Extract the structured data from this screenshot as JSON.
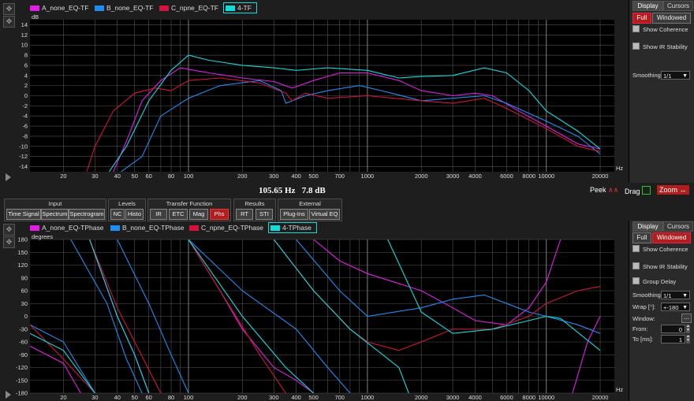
{
  "colors": {
    "A": "#e21ee6",
    "B": "#1e8ef0",
    "C": "#d2143c",
    "D": "#10dcdc",
    "bg": "#000000",
    "grid": "#6e6e6e"
  },
  "top_legend": [
    {
      "label": "A_none_EQ-TF",
      "color": "#e21ee6"
    },
    {
      "label": "B_none_EQ-TF",
      "color": "#1e8ef0"
    },
    {
      "label": "C_npne_EQ-TF",
      "color": "#d2143c"
    },
    {
      "label": "4-TF",
      "color": "#10dcdc"
    }
  ],
  "bottom_legend": [
    {
      "label": "A_none_EQ-TPhase",
      "color": "#e21ee6"
    },
    {
      "label": "B_none_EQ-TPhase",
      "color": "#1e8ef0"
    },
    {
      "label": "C_npne_EQ-TPhase",
      "color": "#d2143c"
    },
    {
      "label": "4-TPhase",
      "color": "#10dcdc"
    }
  ],
  "readout": {
    "freq": "105.65 Hz",
    "level": "7.8 dB"
  },
  "status": {
    "peek": "Peek",
    "drag": "Drag",
    "zoom": "Zoom"
  },
  "right_top": {
    "tab_display": "Display",
    "tab_cursors": "Cursors",
    "full": "Full",
    "windowed": "Windowed",
    "show_coherence": "Show Coherence",
    "show_ir": "Show IR Stability",
    "smoothing_label": "Smoothing",
    "smoothing_value": "1/1"
  },
  "right_bottom": {
    "tab_display": "Display",
    "tab_cursors": "Cursors",
    "full": "Full",
    "windowed": "Windowed",
    "show_coherence": "Show Coherence",
    "show_ir": "Show IR Stability",
    "group_delay": "Group Delay",
    "smoothing_label": "Smoothing",
    "smoothing_value": "1/1",
    "wrap_label": "Wrap [°]:",
    "wrap_value": "+-180",
    "window_label": "Window:",
    "window_btn": "...",
    "from_label": "From:",
    "from_value": "0",
    "to_label": "To [ms]:",
    "to_value": "1"
  },
  "toolbar": {
    "input": {
      "title": "Input",
      "buttons": [
        "Time Signal",
        "Spectrum",
        "Spectrogram"
      ]
    },
    "levels": {
      "title": "Levels",
      "buttons": [
        "NC",
        "Histo"
      ]
    },
    "transfer": {
      "title": "Transfer Function",
      "buttons": [
        "IR",
        "ETC",
        "Mag",
        "Phs"
      ]
    },
    "results": {
      "title": "Results",
      "buttons": [
        "RT",
        "STI"
      ]
    },
    "external": {
      "title": "External",
      "buttons": [
        "Plug-Ins",
        "Virtual EQ"
      ]
    }
  },
  "chart_data": [
    {
      "type": "line",
      "ylabel": "dB",
      "xlabel": "Hz",
      "xscale": "log",
      "xlim": [
        13,
        24000
      ],
      "ylim": [
        -15,
        15
      ],
      "yticks": [
        14,
        12,
        10,
        8,
        6,
        4,
        2,
        0,
        -2,
        -4,
        -6,
        -8,
        -10,
        -12,
        -14
      ],
      "xticks": [
        20,
        30,
        40,
        50,
        60,
        80,
        100,
        200,
        300,
        400,
        500,
        700,
        1000,
        2000,
        3000,
        4000,
        6000,
        8000,
        10000,
        20000
      ],
      "series": [
        {
          "name": "A_none_EQ-TF",
          "color": "#e21ee6",
          "points": [
            [
              38,
              -15
            ],
            [
              45,
              -9
            ],
            [
              55,
              -1
            ],
            [
              70,
              3
            ],
            [
              90,
              5.5
            ],
            [
              130,
              4.5
            ],
            [
              200,
              3.5
            ],
            [
              300,
              2.8
            ],
            [
              380,
              1.5
            ],
            [
              500,
              3
            ],
            [
              700,
              4.5
            ],
            [
              1000,
              4.5
            ],
            [
              1500,
              3
            ],
            [
              2000,
              1
            ],
            [
              3000,
              0
            ],
            [
              4000,
              0.5
            ],
            [
              5000,
              0
            ],
            [
              7000,
              -3
            ],
            [
              10000,
              -6
            ],
            [
              15000,
              -9.5
            ],
            [
              20000,
              -10.5
            ]
          ]
        },
        {
          "name": "B_none_EQ-TF",
          "color": "#1e8ef0",
          "points": [
            [
              42,
              -15
            ],
            [
              55,
              -12
            ],
            [
              70,
              -4
            ],
            [
              100,
              -0.5
            ],
            [
              150,
              2
            ],
            [
              250,
              3
            ],
            [
              330,
              1
            ],
            [
              350,
              -1.5
            ],
            [
              450,
              0
            ],
            [
              600,
              1
            ],
            [
              900,
              2
            ],
            [
              1200,
              1
            ],
            [
              2000,
              -1
            ],
            [
              3000,
              -0.5
            ],
            [
              4500,
              0
            ],
            [
              6000,
              -1.5
            ],
            [
              10000,
              -5
            ],
            [
              15000,
              -8
            ],
            [
              20000,
              -11.5
            ]
          ]
        },
        {
          "name": "C_npne_EQ-TF",
          "color": "#d2143c",
          "points": [
            [
              27,
              -15
            ],
            [
              30,
              -10
            ],
            [
              38,
              -3
            ],
            [
              50,
              0.5
            ],
            [
              65,
              1.5
            ],
            [
              80,
              1
            ],
            [
              100,
              3
            ],
            [
              150,
              3.5
            ],
            [
              250,
              2.5
            ],
            [
              350,
              0.5
            ],
            [
              380,
              -1
            ],
            [
              450,
              0.5
            ],
            [
              600,
              -0.5
            ],
            [
              1000,
              0
            ],
            [
              2000,
              -1
            ],
            [
              3000,
              -1.5
            ],
            [
              4500,
              -0.5
            ],
            [
              6000,
              -2.5
            ],
            [
              10000,
              -6.5
            ],
            [
              15000,
              -10
            ],
            [
              20000,
              -11
            ]
          ]
        },
        {
          "name": "4-TF",
          "color": "#10dcdc",
          "points": [
            [
              36,
              -15
            ],
            [
              45,
              -10
            ],
            [
              60,
              -1
            ],
            [
              80,
              5
            ],
            [
              100,
              8
            ],
            [
              130,
              7
            ],
            [
              200,
              6
            ],
            [
              300,
              5.5
            ],
            [
              400,
              5
            ],
            [
              600,
              5.5
            ],
            [
              1000,
              5
            ],
            [
              1500,
              3.5
            ],
            [
              2000,
              3.8
            ],
            [
              3000,
              4
            ],
            [
              4500,
              5.5
            ],
            [
              6000,
              4.5
            ],
            [
              8000,
              1
            ],
            [
              10000,
              -3
            ],
            [
              15000,
              -7
            ],
            [
              20000,
              -10.5
            ]
          ]
        }
      ]
    },
    {
      "type": "line",
      "ylabel": "degrees",
      "xlabel": "Hz",
      "xscale": "log",
      "xlim": [
        13,
        24000
      ],
      "ylim": [
        -180,
        180
      ],
      "yticks": [
        180,
        150,
        120,
        90,
        60,
        30,
        0,
        -30,
        -60,
        -90,
        -120,
        -150,
        -180
      ],
      "xticks": [
        20,
        30,
        40,
        50,
        60,
        80,
        100,
        200,
        300,
        400,
        500,
        700,
        1000,
        2000,
        3000,
        4000,
        6000,
        8000,
        10000,
        20000
      ],
      "series": [
        {
          "name": "A_none_EQ-TPhase",
          "color": "#e21ee6",
          "segments": [
            [
              [
                13,
                -70
              ],
              [
                20,
                -110
              ],
              [
                25,
                -180
              ]
            ],
            [
              [
                28,
                180
              ],
              [
                40,
                0
              ],
              [
                50,
                -90
              ],
              [
                60,
                -180
              ]
            ],
            [
              [
                100,
                180
              ],
              [
                150,
                60
              ],
              [
                200,
                -30
              ],
              [
                300,
                -120
              ],
              [
                400,
                -150
              ],
              [
                500,
                -180
              ]
            ],
            [
              [
                500,
                180
              ],
              [
                700,
                130
              ],
              [
                1000,
                100
              ],
              [
                2000,
                60
              ],
              [
                3000,
                20
              ],
              [
                4000,
                -10
              ],
              [
                6000,
                -20
              ],
              [
                8000,
                20
              ],
              [
                10000,
                80
              ],
              [
                12000,
                180
              ]
            ],
            [
              [
                14000,
                -180
              ],
              [
                17000,
                -60
              ],
              [
                20000,
                0
              ]
            ]
          ]
        },
        {
          "name": "B_none_EQ-TPhase",
          "color": "#1e8ef0",
          "segments": [
            [
              [
                13,
                -20
              ],
              [
                20,
                -60
              ],
              [
                30,
                -180
              ]
            ],
            [
              [
                22,
                180
              ],
              [
                35,
                30
              ],
              [
                45,
                -100
              ],
              [
                55,
                -180
              ]
            ],
            [
              [
                40,
                180
              ],
              [
                60,
                30
              ],
              [
                80,
                -90
              ],
              [
                100,
                -180
              ]
            ],
            [
              [
                100,
                180
              ],
              [
                200,
                60
              ],
              [
                400,
                -30
              ],
              [
                600,
                -120
              ],
              [
                800,
                -180
              ]
            ],
            [
              [
                400,
                180
              ],
              [
                700,
                60
              ],
              [
                1000,
                0
              ],
              [
                2000,
                20
              ],
              [
                3000,
                40
              ],
              [
                4500,
                50
              ],
              [
                6000,
                30
              ],
              [
                8000,
                10
              ],
              [
                10000,
                0
              ],
              [
                15000,
                -20
              ],
              [
                20000,
                -40
              ]
            ]
          ]
        },
        {
          "name": "C_npne_EQ-TPhase",
          "color": "#d2143c",
          "segments": [
            [
              [
                13,
                -20
              ],
              [
                20,
                -100
              ],
              [
                30,
                -180
              ]
            ],
            [
              [
                28,
                180
              ],
              [
                40,
                20
              ],
              [
                50,
                -60
              ],
              [
                70,
                -180
              ]
            ],
            [
              [
                100,
                180
              ],
              [
                150,
                60
              ],
              [
                250,
                -90
              ],
              [
                350,
                -180
              ]
            ],
            [
              [
                300,
                180
              ],
              [
                500,
                60
              ],
              [
                800,
                -30
              ],
              [
                1000,
                -60
              ],
              [
                1500,
                -80
              ],
              [
                2000,
                -60
              ],
              [
                3000,
                -30
              ],
              [
                5000,
                -30
              ],
              [
                8000,
                0
              ],
              [
                10000,
                30
              ],
              [
                15000,
                60
              ],
              [
                20000,
                70
              ]
            ]
          ]
        },
        {
          "name": "4-TPhase",
          "color": "#10dcdc",
          "segments": [
            [
              [
                13,
                -40
              ],
              [
                20,
                -80
              ],
              [
                30,
                -180
              ]
            ],
            [
              [
                28,
                180
              ],
              [
                40,
                0
              ],
              [
                50,
                -90
              ],
              [
                60,
                -180
              ]
            ],
            [
              [
                100,
                180
              ],
              [
                200,
                0
              ],
              [
                350,
                -120
              ],
              [
                500,
                -180
              ]
            ],
            [
              [
                300,
                180
              ],
              [
                500,
                60
              ],
              [
                800,
                -30
              ],
              [
                1500,
                -120
              ],
              [
                1700,
                -180
              ]
            ],
            [
              [
                1300,
                180
              ],
              [
                2000,
                10
              ],
              [
                3000,
                -40
              ],
              [
                5000,
                -30
              ],
              [
                8000,
                -10
              ],
              [
                10000,
                0
              ],
              [
                12000,
                -5
              ],
              [
                20000,
                -80
              ]
            ]
          ]
        }
      ]
    }
  ]
}
